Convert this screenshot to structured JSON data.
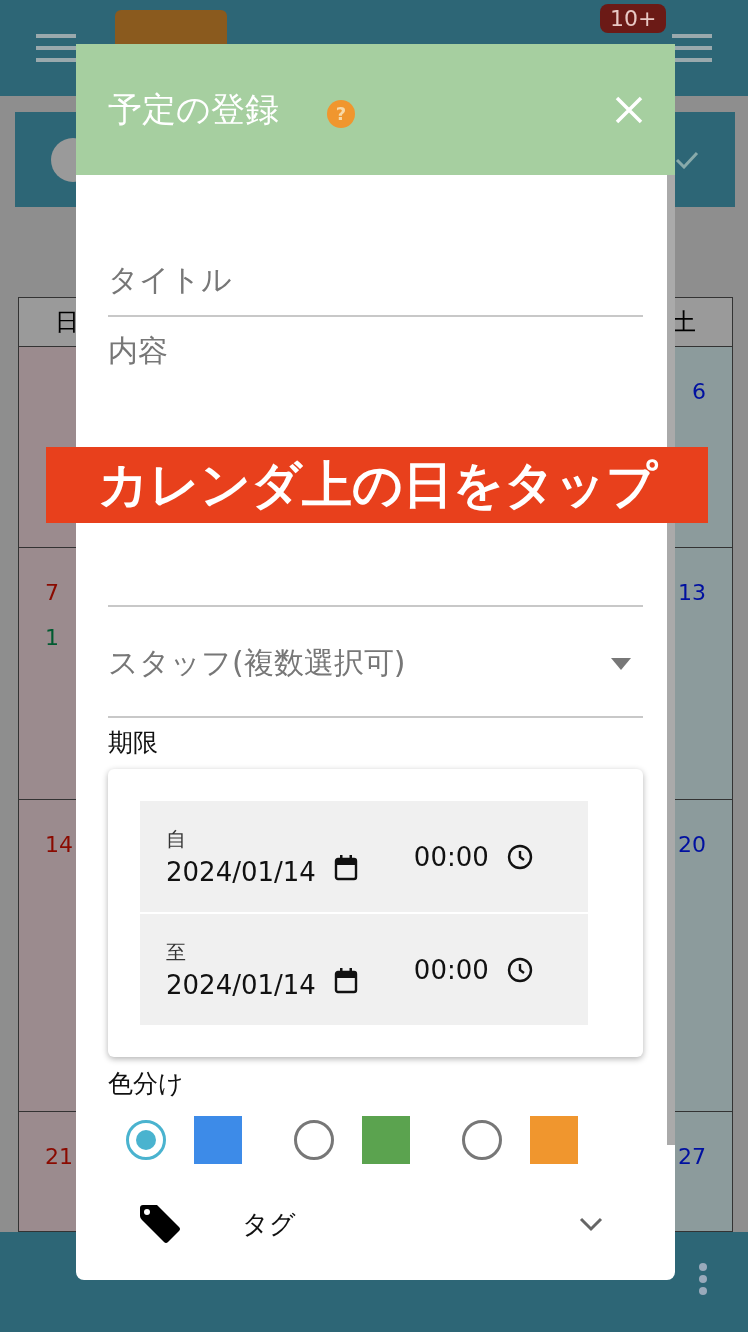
{
  "app_header": {
    "badge": "10+"
  },
  "calendar": {
    "header": {
      "sunday": "日",
      "saturday": "土"
    },
    "weeks": [
      {
        "saturday": "6"
      },
      {
        "sunday": "7",
        "saturday": "13",
        "sunday_event": "1"
      },
      {
        "sunday": "14",
        "saturday": "20"
      },
      {
        "sunday": "21",
        "saturday": "27"
      }
    ]
  },
  "dialog": {
    "title": "予定の登録",
    "help": "?",
    "fields": [
      {
        "kind": "text",
        "placeholder": "タイトル"
      },
      {
        "kind": "textarea",
        "placeholder": "内容"
      },
      {
        "kind": "select",
        "placeholder": "スタッフ(複数選択可)"
      }
    ],
    "deadline": {
      "label": "期限",
      "ranges": [
        {
          "label": "自",
          "date": "2024/01/14",
          "time": "00:00"
        },
        {
          "label": "至",
          "date": "2024/01/14",
          "time": "00:00"
        }
      ]
    },
    "color_label": "色分け",
    "colors": [
      {
        "selected": true,
        "color": "#3d8be8"
      },
      {
        "selected": false,
        "color": "#5ba34f"
      },
      {
        "selected": false,
        "color": "#f0962e"
      }
    ],
    "tag": {
      "label": "タグ",
      "expanded": false
    }
  },
  "banner": {
    "text": "カレンダ上の日をタップ"
  }
}
